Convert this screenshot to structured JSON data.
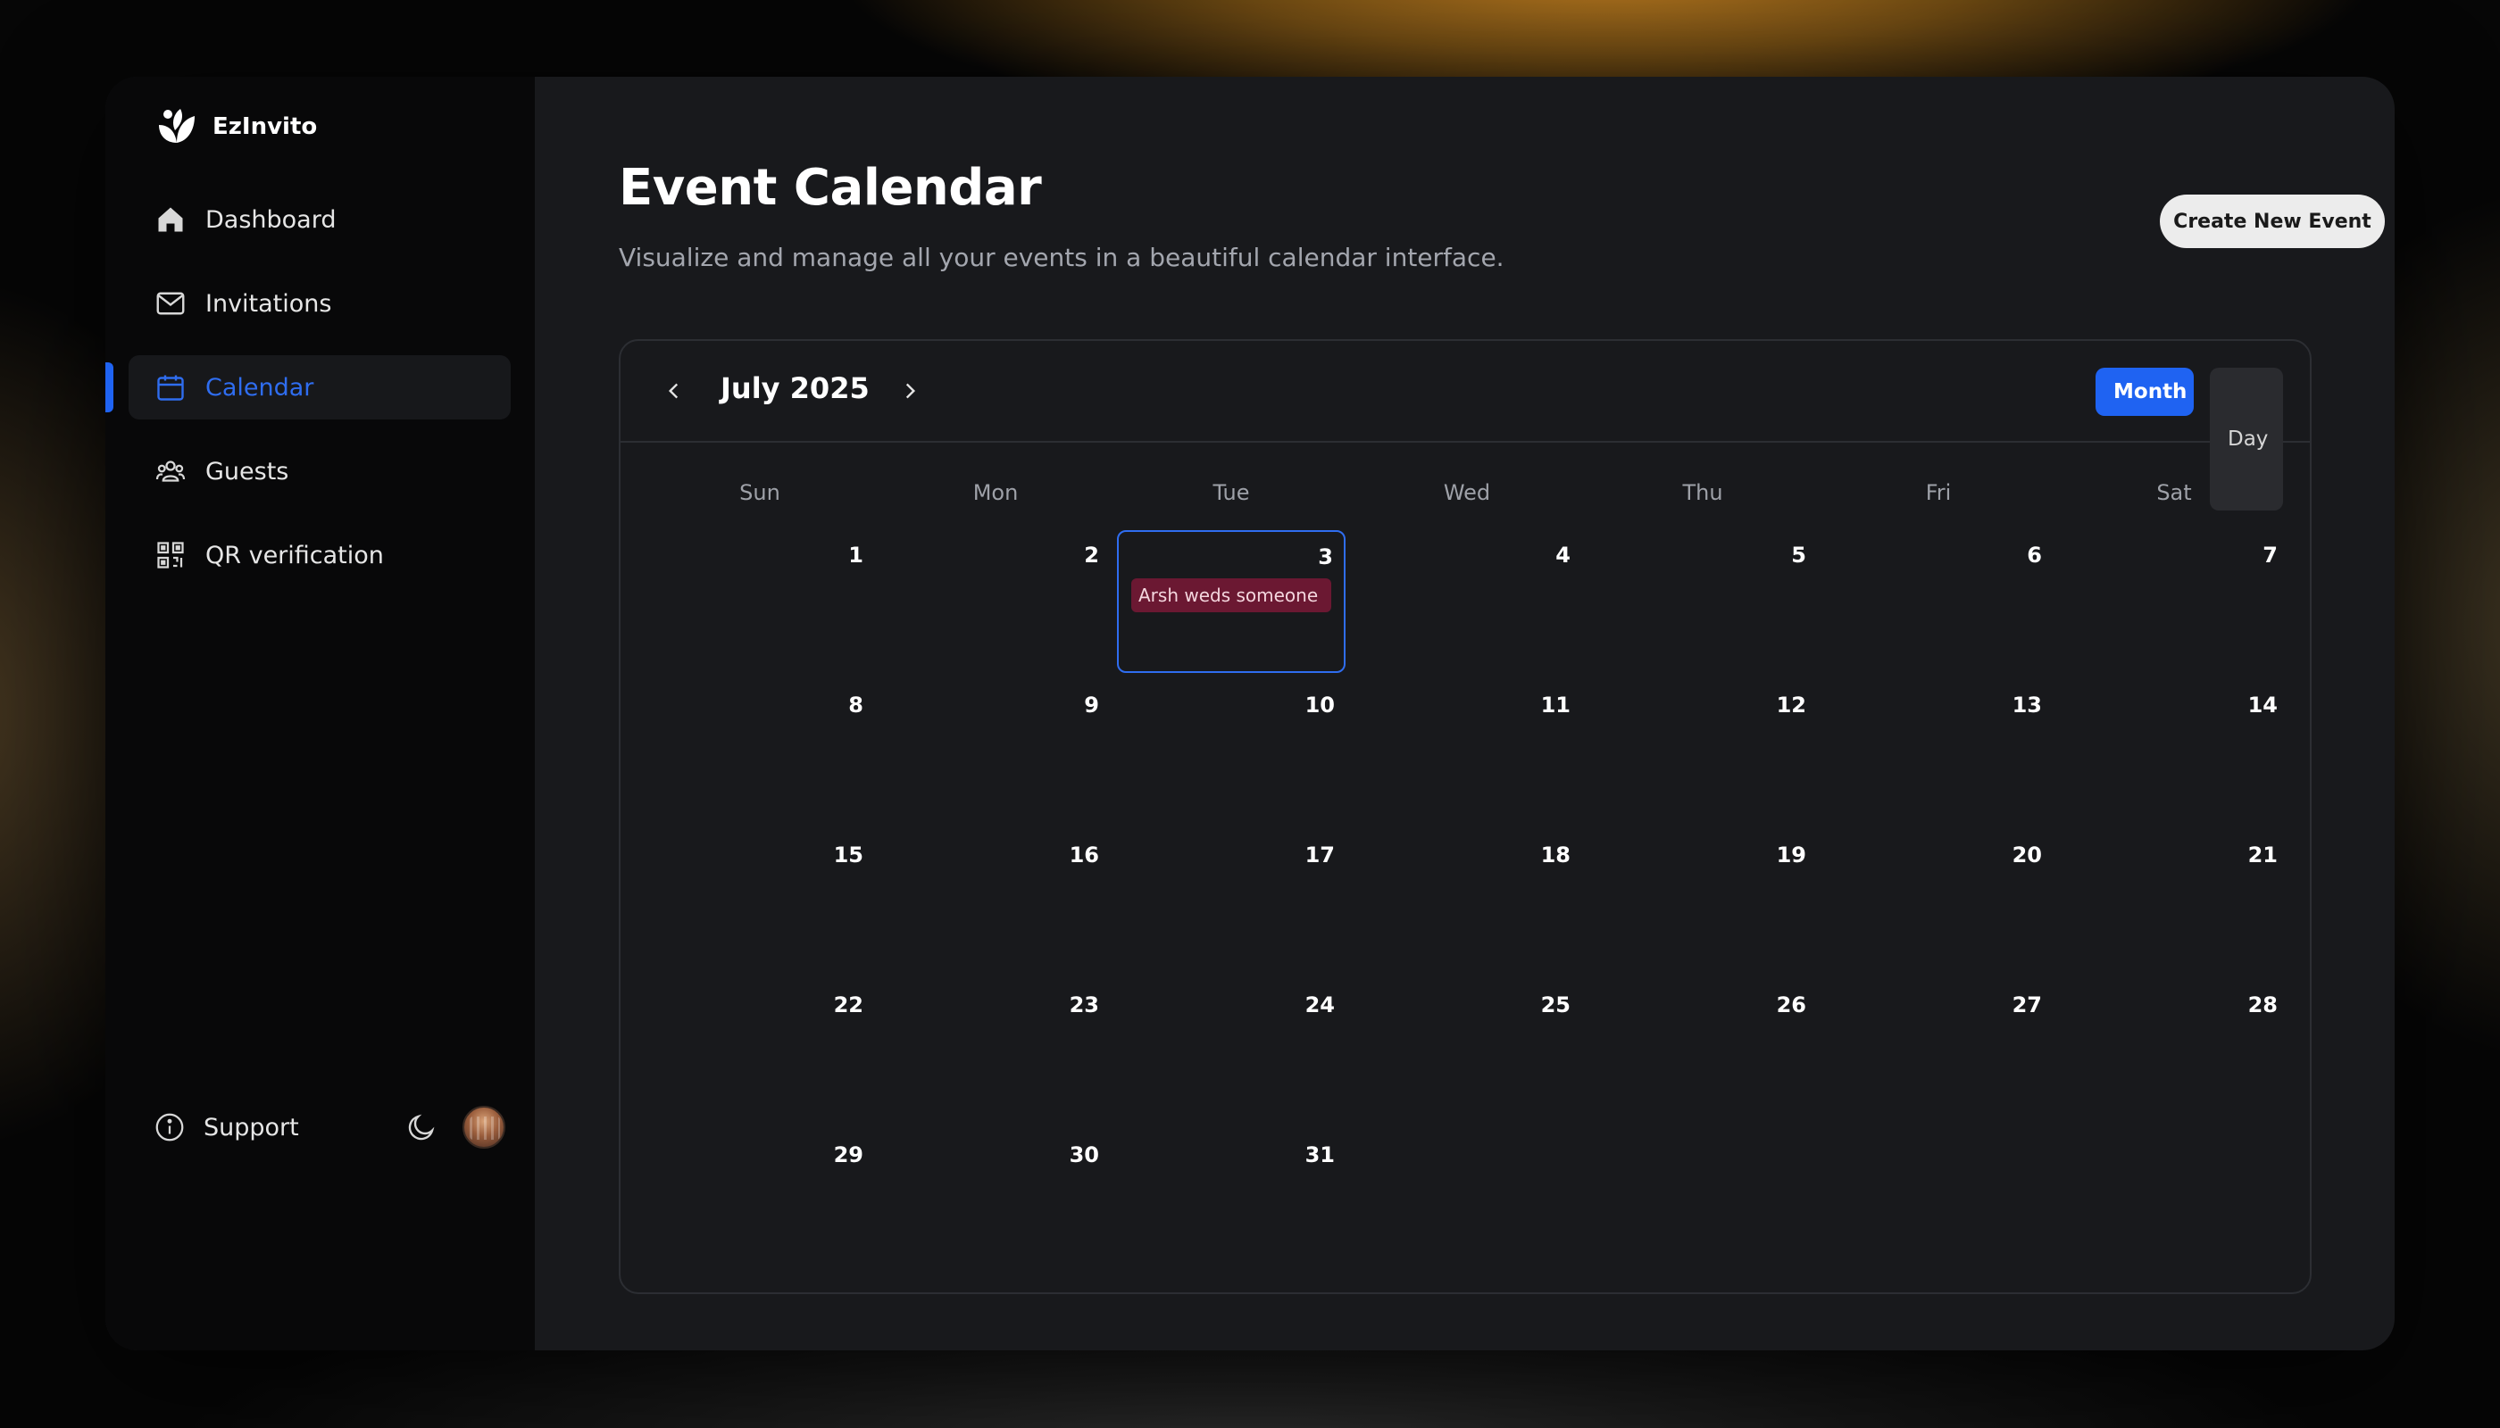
{
  "app": {
    "name": "EzInvito"
  },
  "sidebar": {
    "items": [
      {
        "label": "Dashboard",
        "icon": "home-icon"
      },
      {
        "label": "Invitations",
        "icon": "mail-icon"
      },
      {
        "label": "Calendar",
        "icon": "calendar-icon",
        "active": true
      },
      {
        "label": "Guests",
        "icon": "users-icon"
      },
      {
        "label": "QR verification",
        "icon": "qr-code-icon"
      }
    ],
    "support_label": "Support"
  },
  "page": {
    "title": "Event Calendar",
    "subtitle": "Visualize and manage all your events in a beautiful calendar interface.",
    "create_button": "Create New Event"
  },
  "calendar": {
    "month_label": "July 2025",
    "views": {
      "month": "Month",
      "day": "Day"
    },
    "active_view": "Month",
    "weekdays": [
      "Sun",
      "Mon",
      "Tue",
      "Wed",
      "Thu",
      "Fri",
      "Sat"
    ],
    "selected_day": "3",
    "weeks": [
      [
        "1",
        "2",
        "3",
        "4",
        "5",
        "6",
        "7"
      ],
      [
        "8",
        "9",
        "10",
        "11",
        "12",
        "13",
        "14"
      ],
      [
        "15",
        "16",
        "17",
        "18",
        "19",
        "20",
        "21"
      ],
      [
        "22",
        "23",
        "24",
        "25",
        "26",
        "27",
        "28"
      ],
      [
        "29",
        "30",
        "31",
        "",
        "",
        "",
        ""
      ]
    ],
    "events": [
      {
        "day": "3",
        "title": "Arsh weds someone",
        "color": "#6b1832"
      }
    ]
  },
  "colors": {
    "accent": "#1f63f2",
    "sidebar_bg": "#080809",
    "main_bg": "#18191c"
  }
}
